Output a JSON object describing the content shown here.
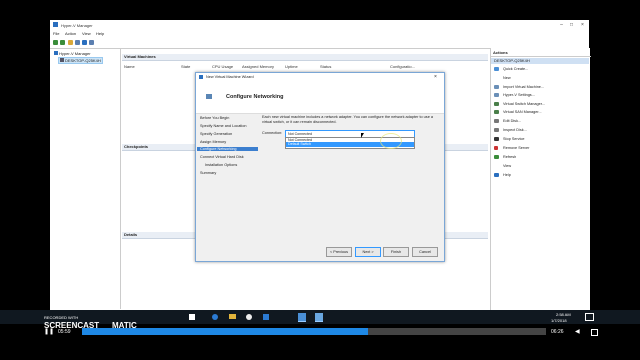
{
  "app": {
    "title": "Hyper-V Manager",
    "menu": [
      "File",
      "Action",
      "View",
      "Help"
    ]
  },
  "tree": {
    "root": "Hyper-V Manager",
    "host": "DESKTOP-Q25K4H"
  },
  "center": {
    "vm_pane_title": "Virtual Machines",
    "columns": [
      "Name",
      "State",
      "CPU Usage",
      "Assigned Memory",
      "Uptime",
      "Status",
      "Configuratio..."
    ],
    "checkpoints_title": "Checkpoints",
    "details_title": "Details"
  },
  "actions": {
    "title": "Actions",
    "host": "DESKTOP-Q25K4H",
    "items": [
      "Quick Create...",
      "New",
      "Import Virtual Machine...",
      "Hyper-V Settings...",
      "Virtual Switch Manager...",
      "Virtual SAN Manager...",
      "Edit Disk...",
      "Inspect Disk...",
      "Stop Service",
      "Remove Server",
      "Refresh",
      "View",
      "Help"
    ]
  },
  "wizard": {
    "title": "New Virtual Machine Wizard",
    "heading": "Configure Networking",
    "steps": [
      "Before You Begin",
      "Specify Name and Location",
      "Specify Generation",
      "Assign Memory",
      "Configure Networking",
      "Connect Virtual Hard Disk",
      "Installation Options",
      "Summary"
    ],
    "description": "Each new virtual machine includes a network adapter. You can configure the network adapter to use a virtual switch, or it can remain disconnected.",
    "connection_label": "Connection:",
    "connection_value": "Not Connected",
    "options": [
      "Not Connected",
      "Default Switch"
    ],
    "buttons": [
      "< Previous",
      "Next >",
      "Finish",
      "Cancel"
    ]
  },
  "taskbar": {
    "time": "2:58 AM",
    "date": "1/7/2018"
  },
  "recorder": {
    "brand": "SCREENCAST",
    "brand2": "MATIC",
    "recorded_with": "RECORDED WITH",
    "elapsed": "05:59",
    "total": "06:26"
  },
  "colors": {
    "accent": "#3399ff",
    "selection": "#3c7fcf",
    "progress": "#1e88e5"
  }
}
